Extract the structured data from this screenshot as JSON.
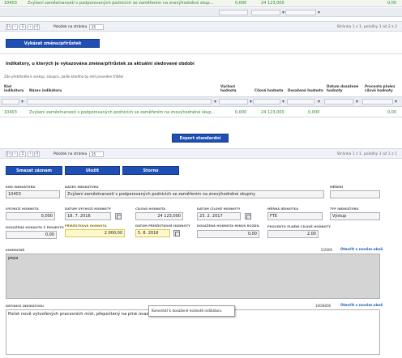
{
  "top_table": {
    "row": {
      "code": "10403",
      "name": "Zvýšení zaměstnanosti v podporovaných podnicích se zaměřením na znevýhodněné skup...",
      "v1": "0,000",
      "v2": "24 123,000",
      "v3": "0,00"
    }
  },
  "pager1": {
    "page": "1",
    "per_page_label": "Položek na stránku",
    "per_page": "25",
    "info": "Stránka 1 z 1, položky 1 až 2 z 2"
  },
  "report_button": "Vykázat změnu/přírůstek",
  "indicators_section": {
    "title": "Indikátory, u kterých je vykazována změna/přírůstek za aktuální sledované období",
    "hint": "Zde přetáhněte k seskup. sloupce, podle kterého by měl proveden třídění",
    "columns": [
      "Kód indikátoru",
      "Název indikátoru",
      "Výchozí hodnota",
      "Cílová hodnota",
      "Dosažená hodnota",
      "Datum dosažené hodnoty",
      "Procento plnění cílové hodnoty"
    ],
    "row": {
      "code": "10403",
      "name": "Zvýšení zaměstnanosti v podporovaných podnicích se zaměřením na znevýhodněné skup...",
      "initial": "0,000",
      "target": "24 123,000",
      "achieved": "0,000",
      "date": "",
      "percent": "0,00"
    }
  },
  "export_button": "Export standardní",
  "pager2": {
    "page": "1",
    "per_page_label": "Položek na stránku",
    "per_page": "25",
    "info": "Stránka 1 z 1, položky 1 až 1 z 1"
  },
  "actions": {
    "delete": "Smazat záznam",
    "save": "Uložit",
    "cancel": "Storno"
  },
  "form": {
    "code_label": "KÓD INDIKÁTORU",
    "code": "10403",
    "name_label": "NÁZEV INDIKÁTORU",
    "name": "Zvýšení zaměstnanosti v podporovaných podnicích se zaměřením na znevýhodněné skupiny",
    "type_label": "MĚŘENÍ",
    "type": "",
    "initial_label": "VÝCHOZÍ HODNOTA",
    "initial": "0,000",
    "initial_date_label": "DATUM VÝCHOZÍ HODNOTY",
    "initial_date": "18. 7. 2016",
    "target_label": "CÍLOVÁ HODNOTA",
    "target": "24 123,000",
    "target_date_label": "DATUM CÍLOVÉ HODNOTY",
    "target_date": "23. 2. 2017",
    "unit_label": "MĚRNÁ JEDNOTKA",
    "unit": "FTE",
    "ind_type_label": "TYP INDIKÁTORU",
    "ind_type": "Výstup",
    "achieved_project_label": "DOSAŽENÁ HODNOTA Z PROJEKTU",
    "achieved_project": "0,00",
    "increment_label": "PŘÍRŮSTKOVÁ HODNOTA",
    "increment": "2 000,00",
    "increment_date_label": "DATUM PŘÍRŮSTKOVÉ HODNOTY",
    "increment_date": "5. 8. 2016",
    "achieved_prev_label": "DOSAŽENÁ HODNOTA MINUS ROZDÍL",
    "achieved_prev": "0,00",
    "percent_label": "PROCENTO PLNĚNÍ CÍLOVÉ HODNOTY",
    "percent": "2,00",
    "comment_label": "KOMENTÁŘ",
    "comment_count": "5/2000",
    "comment_link": "Otevřít v novém okně",
    "comment": "pepa",
    "definition_label": "DEFINICE INDIKÁTORU",
    "definition_count": "100/8000",
    "definition_link": "Otevřít v novém okně",
    "definition": "Počet nově vytvořených pracovních míst, přepočtený na plné úvazky",
    "tooltip": "Komentář k dosažené hodnotě indikátoru"
  }
}
